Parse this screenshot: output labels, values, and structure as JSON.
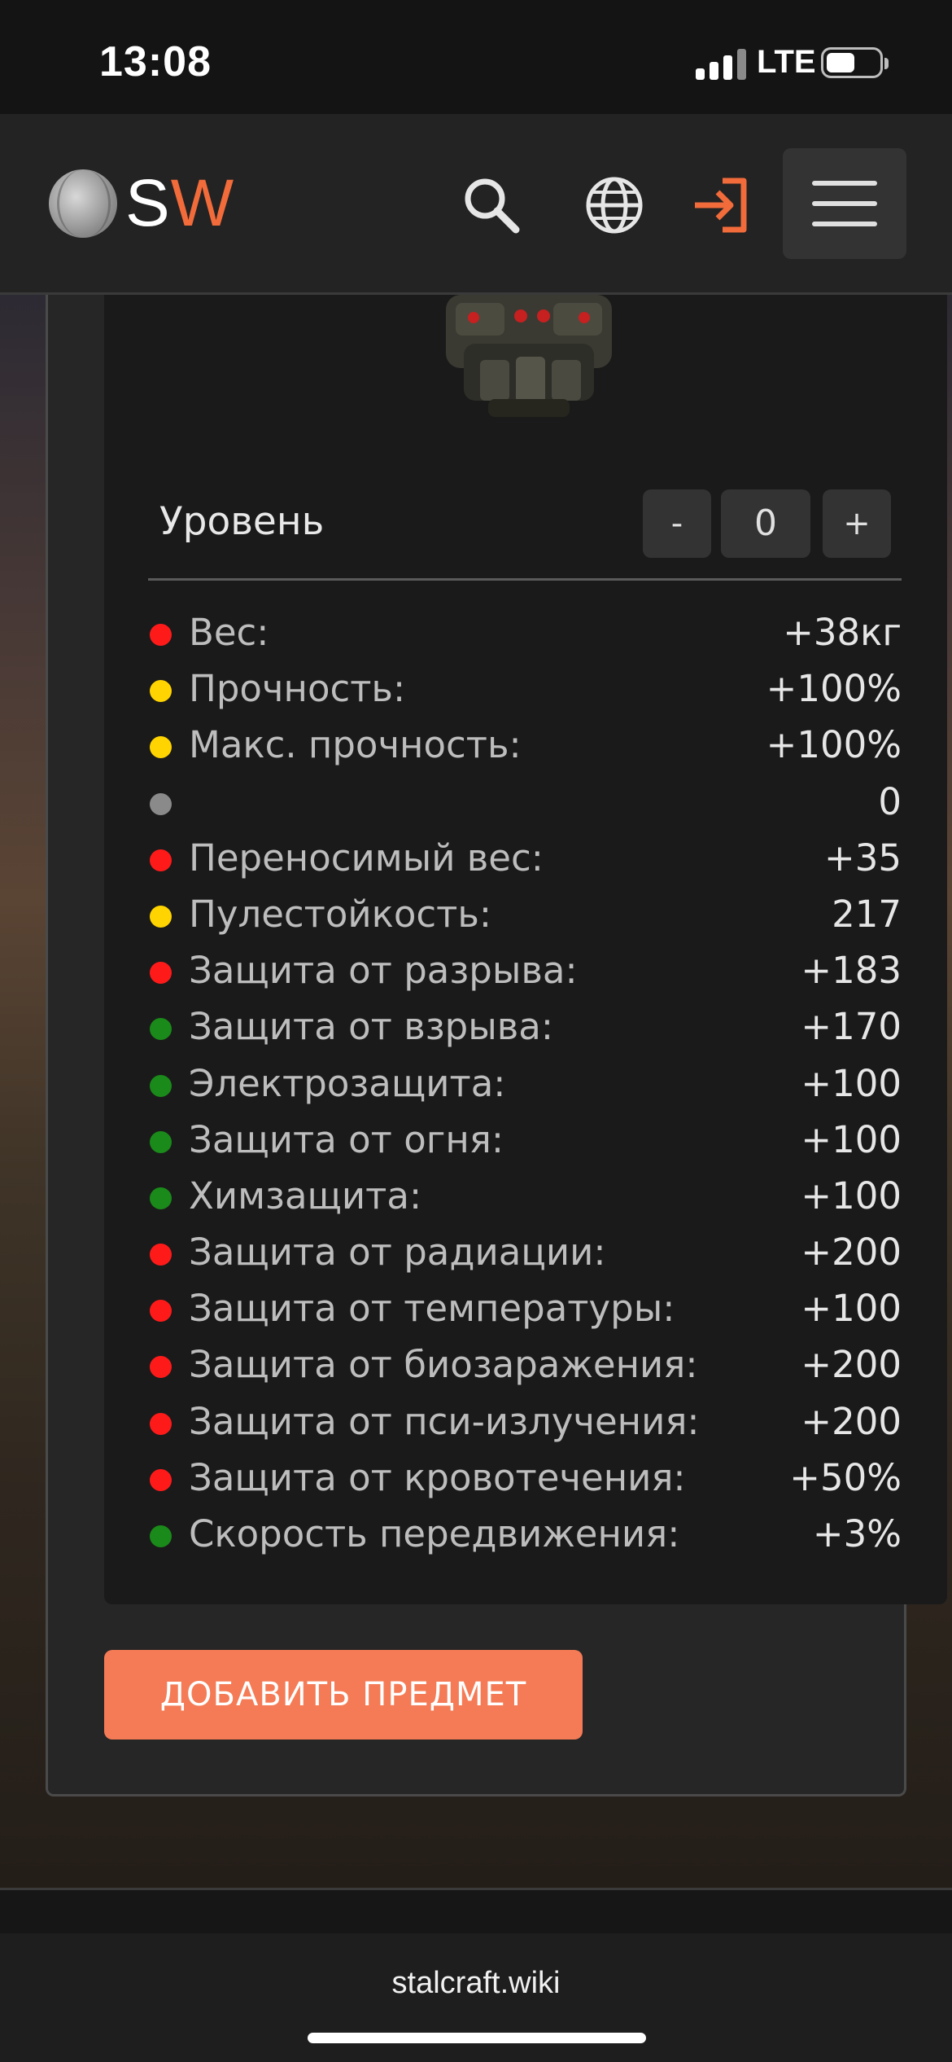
{
  "status_bar": {
    "time": "13:08",
    "network": "LTE",
    "signal_bars": 3,
    "battery_level": 0.55
  },
  "header": {
    "logo": {
      "letter_s": "S",
      "letter_w": "W"
    },
    "icons": [
      "search-icon",
      "globe-icon",
      "login-icon",
      "menu-icon"
    ],
    "accent_color": "#f26b3a"
  },
  "item": {
    "level_label": "Уровень",
    "decrement_label": "-",
    "increment_label": "+",
    "level_value": "0"
  },
  "stats": [
    {
      "label": "Вес:",
      "value": "+38кг",
      "color": "#ff1a1a"
    },
    {
      "label": "Прочность:",
      "value": "+100%",
      "color": "#ffd400"
    },
    {
      "label": "Макс. прочность:",
      "value": "+100%",
      "color": "#ffd400"
    },
    {
      "label": "",
      "value": "0",
      "color": "#8a8a8a"
    },
    {
      "label": "Переносимый вес:",
      "value": "+35",
      "color": "#ff1a1a"
    },
    {
      "label": "Пулестойкость:",
      "value": "217",
      "color": "#ffd400"
    },
    {
      "label": "Защита от разрыва:",
      "value": "+183",
      "color": "#ff1a1a"
    },
    {
      "label": "Защита от взрыва:",
      "value": "+170",
      "color": "#1a8a1a"
    },
    {
      "label": "Электрозащита:",
      "value": "+100",
      "color": "#1a8a1a"
    },
    {
      "label": "Защита от огня:",
      "value": "+100",
      "color": "#1a8a1a"
    },
    {
      "label": "Химзащита:",
      "value": "+100",
      "color": "#1a8a1a"
    },
    {
      "label": "Защита от радиации:",
      "value": "+200",
      "color": "#ff1a1a"
    },
    {
      "label": "Защита от температуры:",
      "value": "+100",
      "color": "#ff1a1a"
    },
    {
      "label": "Защита от биозаражения:",
      "value": "+200",
      "color": "#ff1a1a"
    },
    {
      "label": "Защита от пси-излучения:",
      "value": "+200",
      "color": "#ff1a1a"
    },
    {
      "label": "Защита от кровотечения:",
      "value": "+50%",
      "color": "#ff1a1a"
    },
    {
      "label": "Скорость передвижения:",
      "value": "+3%",
      "color": "#1a8a1a"
    }
  ],
  "add_button_label": "ДОБАВИТЬ ПРЕДМЕТ",
  "browser": {
    "url": "stalcraft.wiki"
  }
}
